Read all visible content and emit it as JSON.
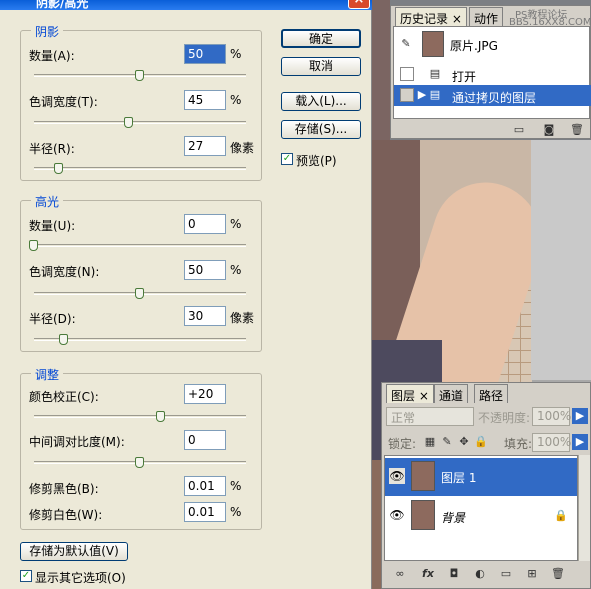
{
  "dialog": {
    "title": "阴影/高光",
    "close": "×",
    "shadows": {
      "legend": "阴影",
      "amount_label": "数量(A):",
      "amount_value": "50",
      "amount_unit": "%",
      "amount_level": 0.5,
      "tonal_label": "色调宽度(T):",
      "tonal_value": "45",
      "tonal_unit": "%",
      "tonal_level": 0.45,
      "radius_label": "半径(R):",
      "radius_value": "27",
      "radius_unit": "像素",
      "radius_level": 0.12
    },
    "highlights": {
      "legend": "高光",
      "amount_label": "数量(U):",
      "amount_value": "0",
      "amount_unit": "%",
      "amount_level": 0.0,
      "tonal_label": "色调宽度(N):",
      "tonal_value": "50",
      "tonal_unit": "%",
      "tonal_level": 0.5,
      "radius_label": "半径(D):",
      "radius_value": "30",
      "radius_unit": "像素",
      "radius_level": 0.14
    },
    "adjustments": {
      "legend": "调整",
      "color_label": "颜色校正(C):",
      "color_value": "+20",
      "color_level": 0.6,
      "midtone_label": "中间调对比度(M):",
      "midtone_value": "0",
      "midtone_level": 0.5,
      "black_label": "修剪黑色(B):",
      "black_value": "0.01",
      "black_unit": "%",
      "white_label": "修剪白色(W):",
      "white_value": "0.01",
      "white_unit": "%"
    },
    "buttons": {
      "ok": "确定",
      "cancel": "取消",
      "load": "载入(L)...",
      "save": "存储(S)...",
      "save_default": "存储为默认值(V)"
    },
    "preview_label": "预览(P)",
    "show_more_label": "显示其它选项(O)",
    "checkmark": "✓"
  },
  "history": {
    "tabs": [
      "历史记录",
      "动作"
    ],
    "close": "×",
    "watermark": "PS教程论坛",
    "watermark2": "BBS.16XX8.COM",
    "snapshot_label": "原片.JPG",
    "items": [
      "打开",
      "通过拷贝的图层"
    ]
  },
  "layers": {
    "tabs": [
      "图层",
      "通道",
      "路径"
    ],
    "blend_mode": "正常",
    "opacity_label": "不透明度:",
    "opacity_value": "100%",
    "lock_label": "锁定:",
    "fill_label": "填充:",
    "fill_value": "100%",
    "items": [
      {
        "name": "图层 1",
        "selected": true
      },
      {
        "name": "背景",
        "selected": false
      }
    ],
    "footer_icons": [
      "link-icon",
      "fx-icon",
      "mask-icon",
      "adjustment-icon",
      "folder-icon",
      "new-layer-icon",
      "trash-icon"
    ]
  },
  "colors": {
    "selection": "#316ac5",
    "legend_text": "#0046d5",
    "dialog_bg": "#ece9d8"
  }
}
